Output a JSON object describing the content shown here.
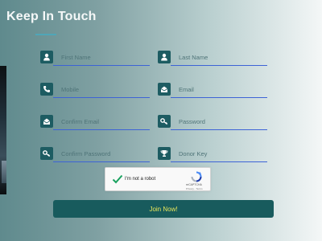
{
  "section": {
    "title": "Keep In Touch"
  },
  "form": {
    "fields": [
      {
        "placeholder": "First Name",
        "icon": "user-icon"
      },
      {
        "placeholder": "Last Name",
        "icon": "user-icon"
      },
      {
        "placeholder": "Mobile",
        "icon": "phone-icon"
      },
      {
        "placeholder": "Email",
        "icon": "envelope-open-icon"
      },
      {
        "placeholder": "Confirm Email",
        "icon": "envelope-open-icon"
      },
      {
        "placeholder": "Password",
        "icon": "key-icon"
      },
      {
        "placeholder": "Confirm Password",
        "icon": "key-icon"
      },
      {
        "placeholder": "Donor Key",
        "icon": "trophy-icon"
      }
    ],
    "captcha": {
      "label": "I'm not a robot",
      "brand": "reCAPTCHA",
      "links": "Privacy - Terms",
      "checked": true
    },
    "submit_label": "Join Now!"
  },
  "colors": {
    "icon_bg": "#1d5c62",
    "underline": "#3d63d6",
    "button_bg": "#185b5d",
    "button_text": "#e9e65a",
    "title_accent": "#4fa6b8"
  }
}
